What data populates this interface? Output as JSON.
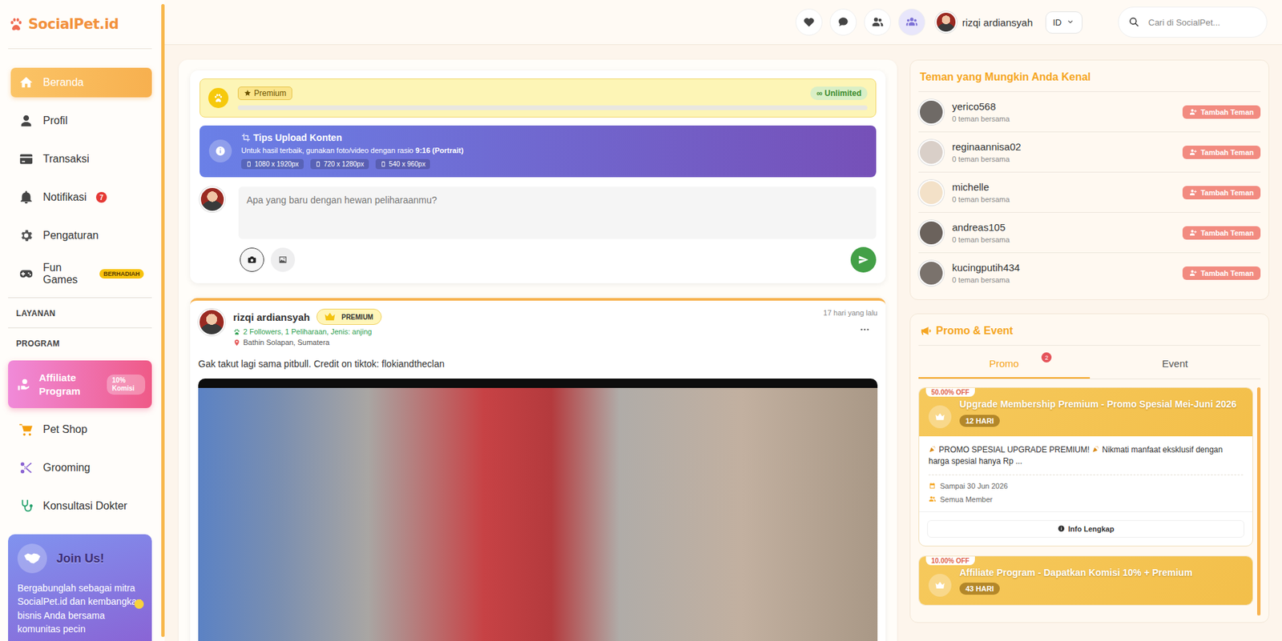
{
  "brand": {
    "name": "SocialPet.id"
  },
  "sidebar": {
    "items": [
      {
        "kind": "nav",
        "label": "Beranda",
        "selected": true,
        "badge": null
      },
      {
        "kind": "nav",
        "label": "Profil",
        "selected": false,
        "badge": null
      },
      {
        "kind": "nav",
        "label": "Transaksi",
        "selected": false,
        "badge": null
      },
      {
        "kind": "nav",
        "label": "Notifikasi",
        "selected": false,
        "badge": {
          "text": "7",
          "kind": "count"
        }
      },
      {
        "kind": "nav",
        "label": "Pengaturan",
        "selected": false,
        "badge": null
      },
      {
        "kind": "nav",
        "label": "Fun Games",
        "selected": false,
        "badge": {
          "text": "BERHADIAH",
          "kind": "tag"
        }
      },
      {
        "kind": "section",
        "label": "LAYANAN",
        "selected": false,
        "badge": null
      },
      {
        "kind": "section",
        "label": "PROGRAM",
        "selected": false,
        "badge": null
      },
      {
        "kind": "affiliate",
        "label": "Affiliate Program",
        "selected": false,
        "badge": {
          "text": "10% Komisi",
          "kind": "pill"
        }
      },
      {
        "kind": "nav",
        "label": "Pet Shop",
        "selected": false,
        "badge": null
      },
      {
        "kind": "nav",
        "label": "Grooming",
        "selected": false,
        "badge": null
      },
      {
        "kind": "nav",
        "label": "Konsultasi Dokter",
        "selected": false,
        "badge": null
      }
    ],
    "join": {
      "title": "Join Us!",
      "text": "Bergabunglah sebagai mitra SocialPet.id dan kembangkan bisnis Anda bersama komunitas pecin"
    }
  },
  "topbar": {
    "actions": [
      {
        "selected": false
      },
      {
        "selected": false
      },
      {
        "selected": false
      },
      {
        "selected": true
      }
    ],
    "user": "rizqi ardiansyah",
    "language": "ID",
    "search_placeholder": "Cari di SocialPet..."
  },
  "composer": {
    "premium": {
      "label": "Premium",
      "quota": "∞ Unlimited",
      "level": 0
    },
    "tips": {
      "title": "Tips Upload Konten",
      "text": "Untuk hasil terbaik, gunakan foto/video dengan rasio ",
      "emphasis": "9:16 (Portrait)",
      "sizes": [
        "1080 x 1920px",
        "720 x 1280px",
        "540 x 960px"
      ]
    },
    "placeholder": "Apa yang baru dengan hewan peliharaanmu?"
  },
  "post": {
    "author": "rizqi ardiansyah",
    "badge": "PREMIUM",
    "stats": "2 Followers, 1 Peliharaan, Jenis: anjing",
    "location": "Bathin Solapan, Sumatera",
    "time": "17 hari yang lalu",
    "caption": "Gak takut lagi sama pitbull. Credit on tiktok: flokiandtheclan"
  },
  "friends": {
    "title": "Teman yang Mungkin Anda Kenal",
    "items": [
      {
        "name": "yerico568",
        "mutual": "0 teman bersama",
        "action": "Tambah Teman"
      },
      {
        "name": "reginaannisa02",
        "mutual": "0 teman bersama",
        "action": "Tambah Teman"
      },
      {
        "name": "michelle",
        "mutual": "0 teman bersama",
        "action": "Tambah Teman"
      },
      {
        "name": "andreas105",
        "mutual": "0 teman bersama",
        "action": "Tambah Teman"
      },
      {
        "name": "kucingputih434",
        "mutual": "0 teman bersama",
        "action": "Tambah Teman"
      }
    ]
  },
  "promo": {
    "title": "Promo & Event",
    "tabs": [
      {
        "label": "Promo",
        "selected": true,
        "badge": "2"
      },
      {
        "label": "Event",
        "selected": false,
        "badge": null
      }
    ],
    "items": [
      {
        "discount": "50.00% OFF",
        "title": "Upgrade Membership Premium - Promo Spesial Mei-Juni 2026",
        "days": "12 HARI",
        "headline": "PROMO SPESIAL UPGRADE PREMIUM!",
        "body": "Nikmati manfaat eksklusif dengan harga spesial hanya Rp ...",
        "until": "Sampai 30 Jun 2026",
        "audience": "Semua Member",
        "action": "Info Lengkap"
      },
      {
        "discount": "10.00% OFF",
        "title": "Affiliate Program - Dapatkan Komisi 10% + Premium",
        "days": "43 HARI",
        "headline": null,
        "body": null,
        "until": null,
        "audience": null,
        "action": null
      }
    ]
  }
}
